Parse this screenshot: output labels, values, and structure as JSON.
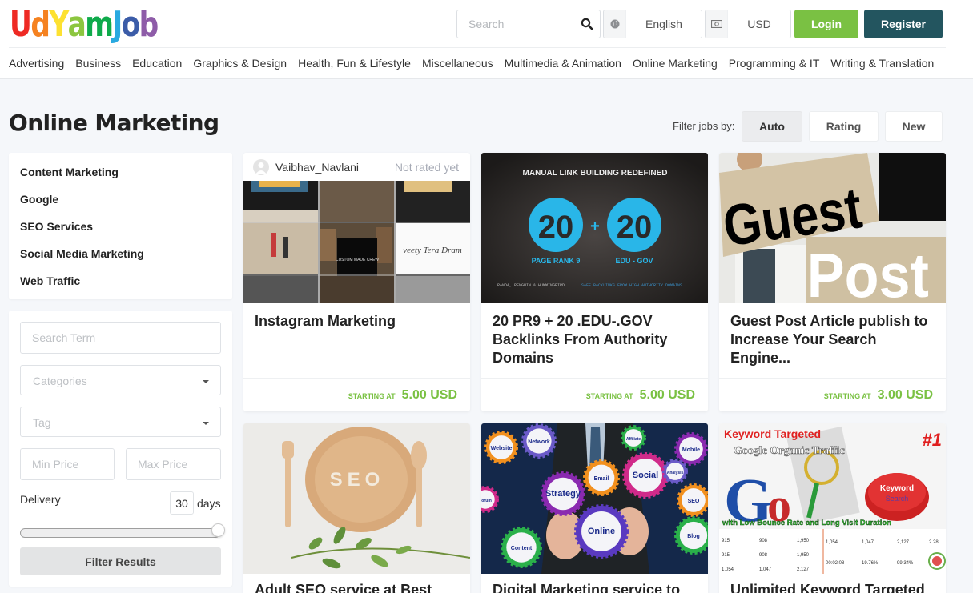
{
  "header": {
    "logo": {
      "letters": [
        "U",
        "d",
        "Y",
        "a",
        "m",
        "J",
        "o",
        "b"
      ],
      "colors": [
        "#ee2a24",
        "#f58220",
        "#fde131",
        "#8cc63f",
        "#0faa4b",
        "#29a9e0",
        "#3b5ca8",
        "#8e5ca8"
      ]
    },
    "search_placeholder": "Search",
    "language": "English",
    "currency": "USD",
    "login_label": "Login",
    "register_label": "Register",
    "nav": [
      "Advertising",
      "Business",
      "Education",
      "Graphics & Design",
      "Health, Fun & Lifestyle",
      "Miscellaneous",
      "Multimedia & Animation",
      "Online Marketing",
      "Programming & IT",
      "Writing & Translation"
    ]
  },
  "page": {
    "title": "Online Marketing",
    "filter_label": "Filter jobs by:",
    "filter_options": [
      "Auto",
      "Rating",
      "New"
    ],
    "filter_active": "Auto"
  },
  "sidebar": {
    "categories": [
      "Content Marketing",
      "Google",
      "SEO Services",
      "Social Media Marketing",
      "Web Traffic"
    ],
    "filters": {
      "search_term_placeholder": "Search Term",
      "categories_placeholder": "Categories",
      "tag_placeholder": "Tag",
      "min_price_placeholder": "Min Price",
      "max_price_placeholder": "Max Price",
      "delivery_label": "Delivery",
      "delivery_days": "30",
      "days_label": "days",
      "delivery_slider_fraction": 1.0,
      "filter_button": "Filter Results"
    }
  },
  "cards": [
    {
      "seller": "Vaibhav_Navlani",
      "rating": "Not rated yet",
      "title": "Instagram Marketing",
      "starting_label": "STARTING AT",
      "price": "5.00 USD",
      "image": "instagram-grid"
    },
    {
      "title": "20 PR9 + 20 .EDU-.GOV Backlinks From Authority Domains",
      "starting_label": "STARTING AT",
      "price": "5.00 USD",
      "image": "backlinks",
      "image_text": {
        "heading": "MANUAL LINK BUILDING REDEFINED",
        "left_num": "20",
        "right_num": "20",
        "plus": "+",
        "left_caption": "PAGE RANK 9",
        "right_caption": "EDU - GOV",
        "footer_left": "PANDA, PENGUIN & HUMMINGBIRD",
        "footer_right": "SAFE BACKLINKS FROM HIGH AUTHORITY DOMAINS"
      }
    },
    {
      "title": "Guest Post Article publish to Increase Your Search Engine...",
      "starting_label": "STARTING AT",
      "price": "3.00 USD",
      "image": "guest-post",
      "image_text": {
        "line1": "Guest",
        "line2": "Post"
      }
    },
    {
      "title": "Adult SEO service at Best",
      "image": "seo-plate",
      "image_text": {
        "word": "SEO"
      }
    },
    {
      "title": "Digital Marketing service to",
      "image": "digital-gears",
      "image_text": {
        "gears": [
          "Website",
          "Network",
          "Affiliate Marketing",
          "Mobile Application",
          "Strategy",
          "Email Marketing",
          "Social Media",
          "Analysis",
          "SEO",
          "Forum",
          "Online Marketing",
          "Content Marketing",
          "Blog Marketing"
        ]
      }
    },
    {
      "title": "Unlimited Keyword Targeted",
      "image": "keyword-traffic",
      "image_text": {
        "line1": "Keyword Targeted",
        "line2": "Google Organic Traffic",
        "badge": "#1",
        "button": "Keyword Search",
        "banner": "with Low Bounce Rate and Long Visit Duration"
      }
    }
  ]
}
